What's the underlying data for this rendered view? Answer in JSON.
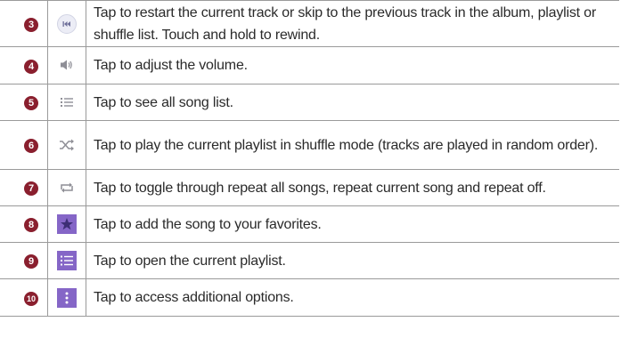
{
  "rows": [
    {
      "num": "3",
      "icon": "skip-previous-icon",
      "text": "Tap to restart the current track or skip to the previous track in the album, playlist or shuffle list. Touch and hold to rewind."
    },
    {
      "num": "4",
      "icon": "volume-icon",
      "text": "Tap to adjust the volume."
    },
    {
      "num": "5",
      "icon": "song-list-icon",
      "text": "Tap to see all song list."
    },
    {
      "num": "6",
      "icon": "shuffle-icon",
      "text": "Tap to play the current playlist in shuffle mode (tracks are played in random order)."
    },
    {
      "num": "7",
      "icon": "repeat-icon",
      "text": "Tap to toggle through repeat all songs, repeat current song and repeat off."
    },
    {
      "num": "8",
      "icon": "favorite-star-icon",
      "text": "Tap to add the song to your favorites."
    },
    {
      "num": "9",
      "icon": "playlist-icon",
      "text": "Tap to open the current playlist."
    },
    {
      "num": "10",
      "icon": "more-options-icon",
      "text": "Tap to access additional options."
    }
  ],
  "colors": {
    "badge": "#8a1f2e",
    "icon_gray": "#8e8e96",
    "accent_purple": "#8566c7"
  }
}
